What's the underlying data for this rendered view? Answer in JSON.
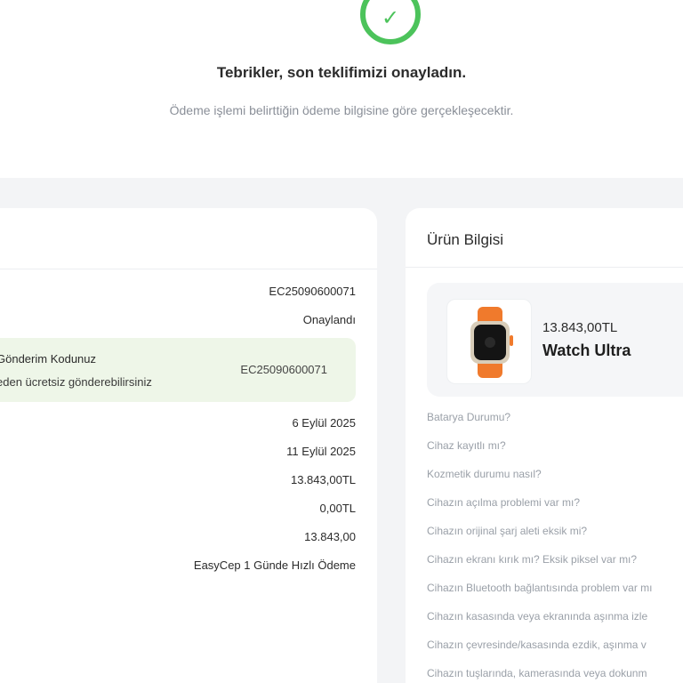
{
  "status": {
    "headline": "Tebrikler, son teklifimizi onayladın.",
    "subline": "Ödeme işlemi belirttiğin ödeme bilgisine göre gerçekleşecektir."
  },
  "order": {
    "order_no": "EC25090600071",
    "status": "Onaylandı",
    "shipping": {
      "title": "Gönderim Kodunuz",
      "note": "eden ücretsiz gönderebilirsiniz",
      "code": "EC25090600071"
    },
    "date1": "6 Eylül 2025",
    "date2": "11 Eylül 2025",
    "price": "13.843,00TL",
    "fee": "0,00TL",
    "total": "13.843,00",
    "payment_method": "EasyCep 1 Günde Hızlı Ödeme"
  },
  "product": {
    "section_title": "Ürün Bilgisi",
    "price": "13.843,00TL",
    "name": "Watch Ultra",
    "questions": [
      "Batarya Durumu?",
      "Cihaz kayıtlı mı?",
      "Kozmetik durumu nasıl?",
      "Cihazın açılma problemi var mı?",
      "Cihazın orijinal şarj aleti eksik mi?",
      "Cihazın ekranı kırık mı? Eksik piksel var mı?",
      "Cihazın Bluetooth bağlantısında problem var mı",
      "Cihazın kasasında veya ekranında aşınma izle",
      "Cihazın çevresinde/kasasında ezdik, aşınma v",
      "Cihazın tuşlarında, kamerasında veya dokunm"
    ]
  },
  "colors": {
    "success": "#4cc35b",
    "highlight_bg": "#eef6e8"
  }
}
